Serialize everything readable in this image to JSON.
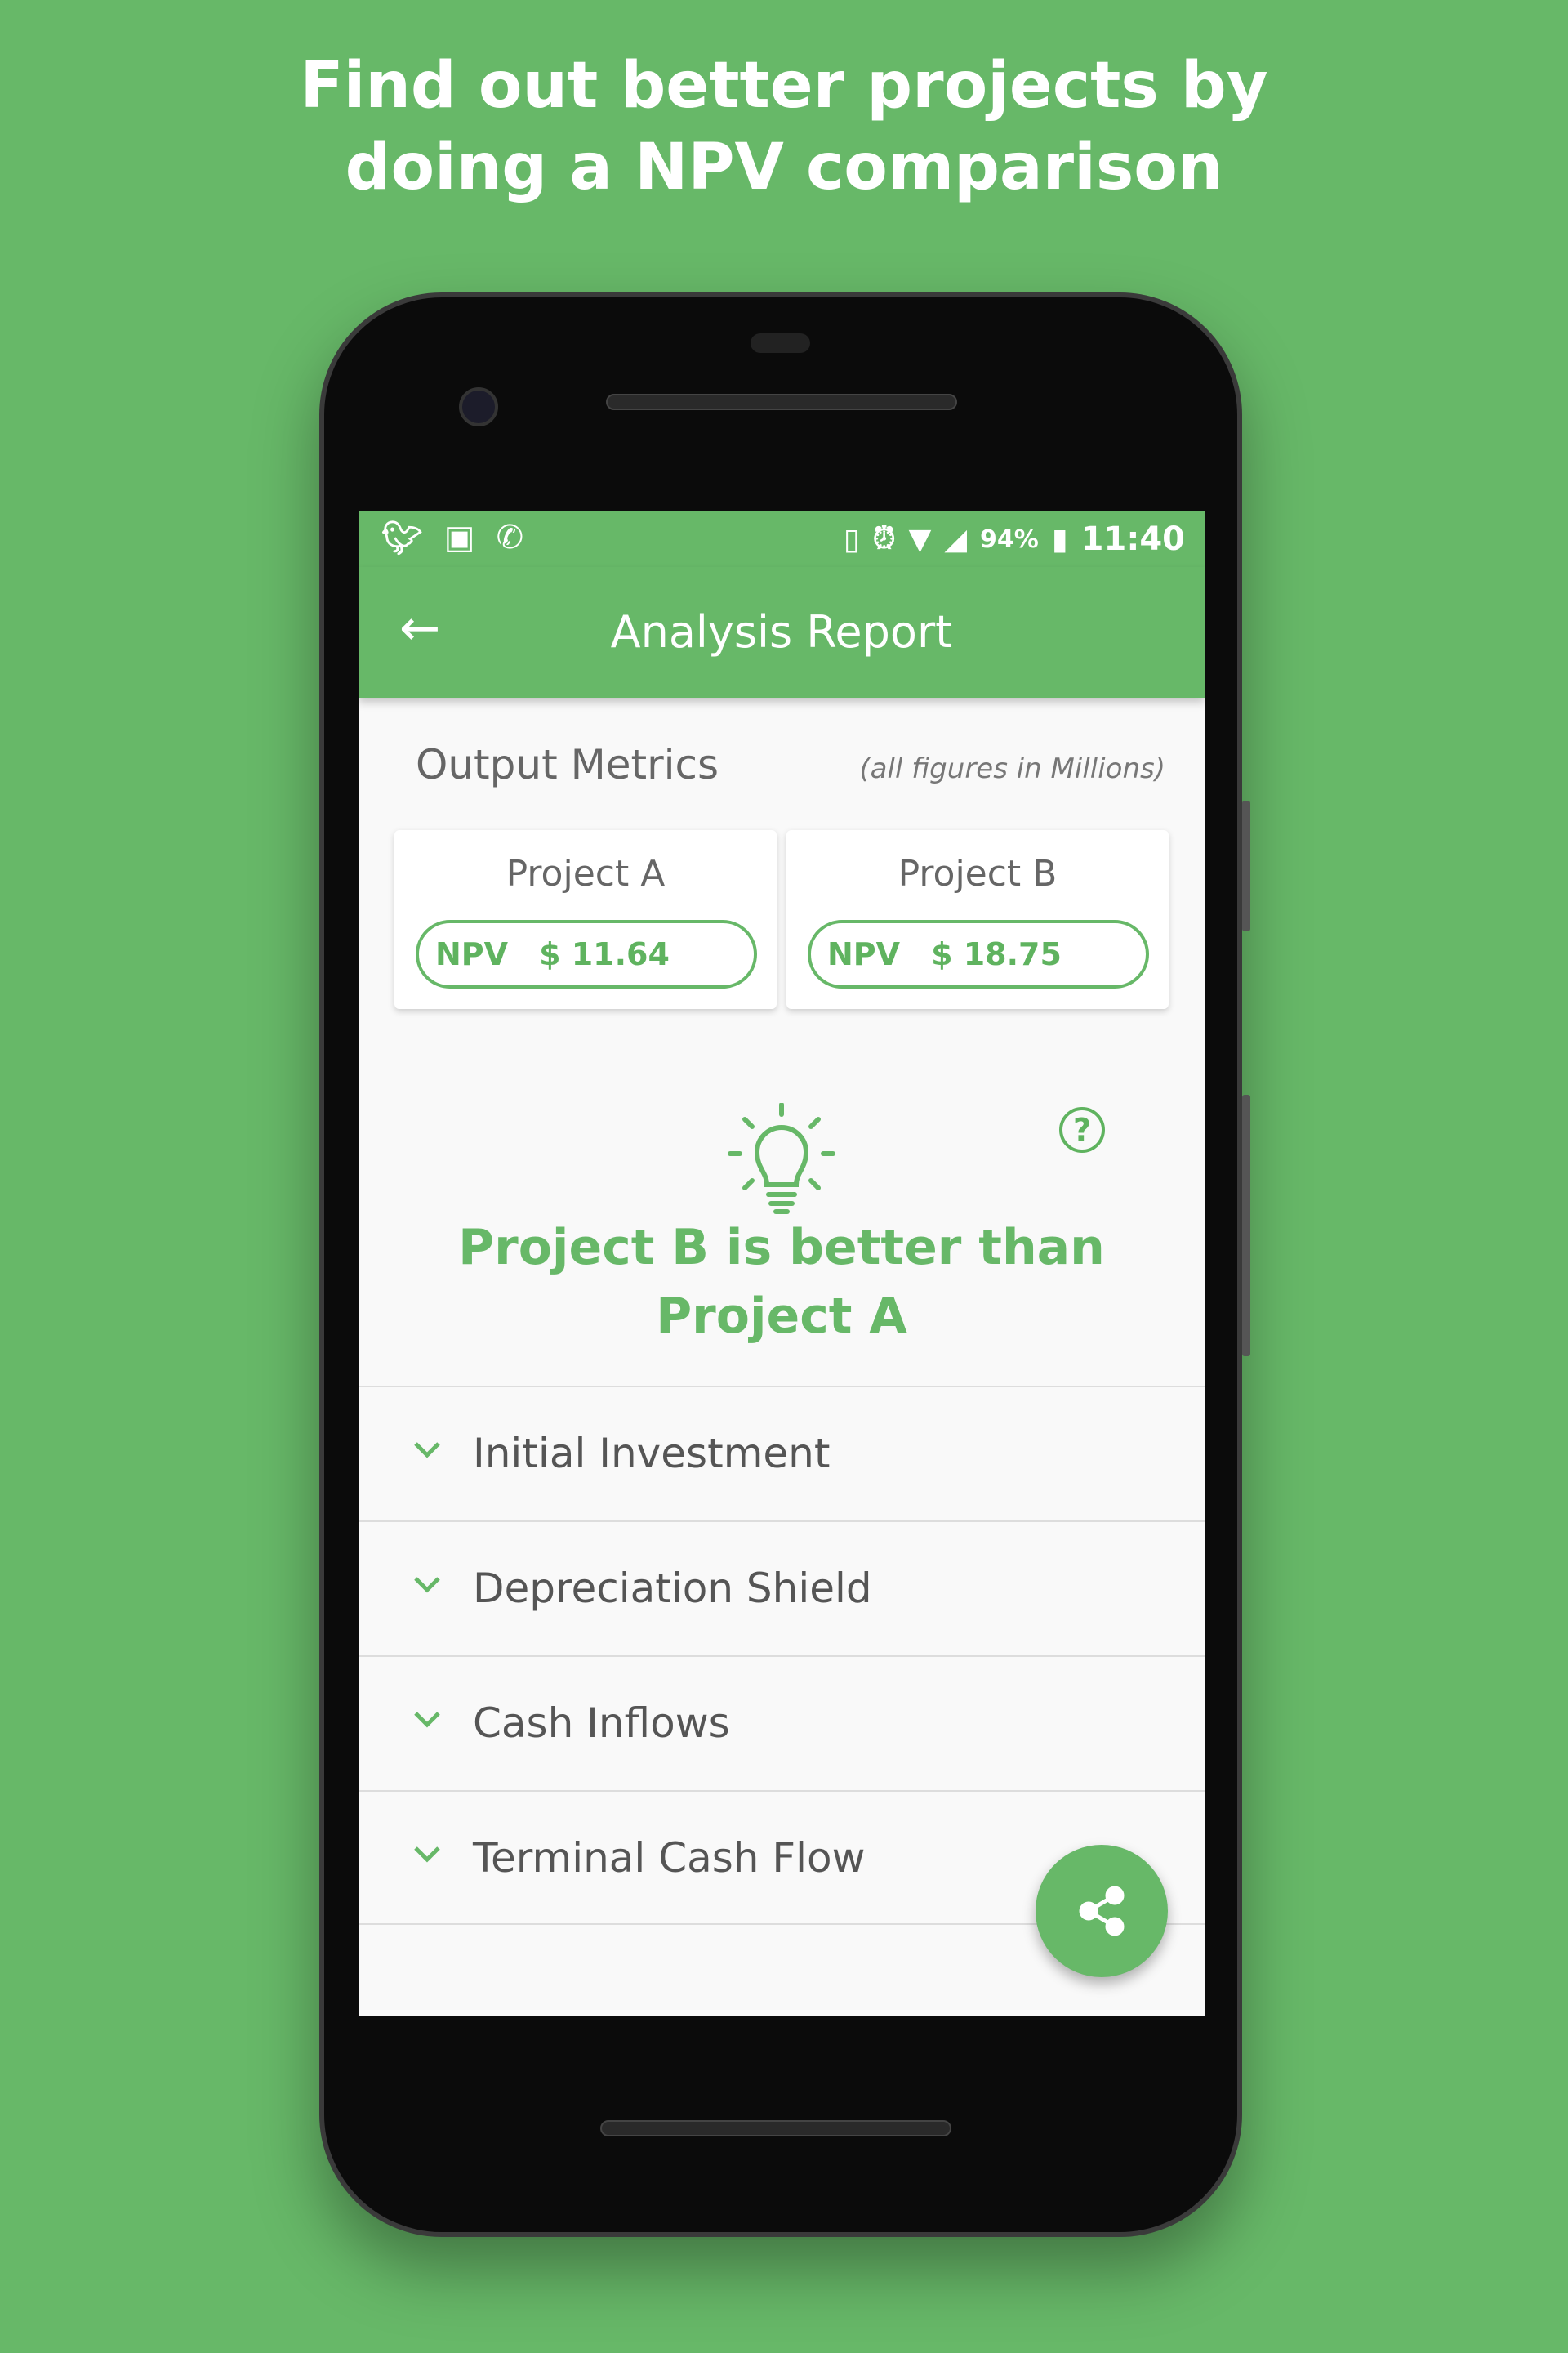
{
  "headline": [
    "Find out better projects by",
    "doing a NPV comparison"
  ],
  "status_bar": {
    "battery": "94%",
    "time": "11:40",
    "left_icons": [
      "twitter-icon",
      "android-icon",
      "missed-call-icon"
    ],
    "right_icons": [
      "vibrate-icon",
      "alarm-icon",
      "wifi-icon",
      "signal-icon",
      "battery-charging-icon"
    ]
  },
  "app_bar": {
    "title": "Analysis Report",
    "back_icon": "arrow-left-icon"
  },
  "output": {
    "heading": "Output Metrics",
    "note": "(all figures in Millions)",
    "projects": [
      {
        "name": "Project A",
        "metric": "NPV",
        "value": "$ 11.64"
      },
      {
        "name": "Project B",
        "metric": "NPV",
        "value": "$ 18.75"
      }
    ]
  },
  "verdict": {
    "lines": [
      "Project B is better than",
      "Project A"
    ],
    "icon": "lightbulb-icon",
    "help_icon": "help-circle-icon"
  },
  "sections": [
    "Initial Investment",
    "Depreciation Shield",
    "Cash Inflows",
    "Terminal Cash Flow"
  ],
  "colors": {
    "brand": "#67b868",
    "background": "#f9f9f9"
  }
}
